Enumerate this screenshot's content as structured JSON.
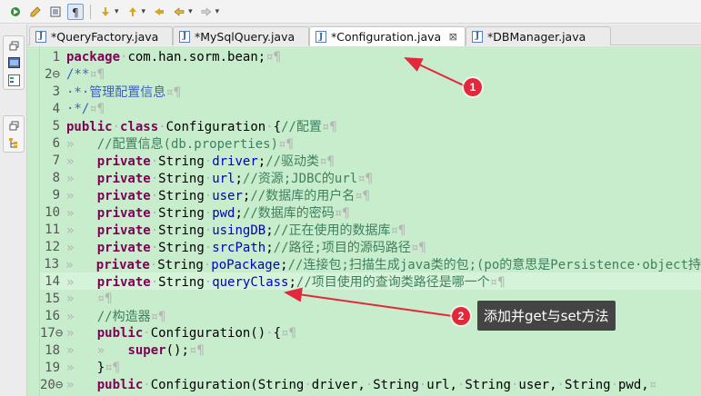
{
  "toolbar": {
    "buttons": [
      {
        "icon": "run-last-icon"
      },
      {
        "icon": "highlight-icon"
      },
      {
        "icon": "block-selection-icon"
      },
      {
        "icon": "show-whitespace-icon"
      },
      {
        "icon": "next-annotation-icon"
      },
      {
        "icon": "previous-annotation-icon"
      },
      {
        "icon": "last-edit-location-icon"
      },
      {
        "icon": "back-icon"
      },
      {
        "icon": "forward-icon"
      }
    ]
  },
  "tabs": [
    {
      "label": "*QueryFactory.java",
      "active": false
    },
    {
      "label": "*MySqlQuery.java",
      "active": false
    },
    {
      "label": "*Configuration.java",
      "active": true,
      "close": "⊠"
    },
    {
      "label": "*DBManager.java",
      "active": false
    }
  ],
  "tab_icon_glyph": "J",
  "code": {
    "lines": [
      {
        "n": "1",
        "tokens": [
          [
            "kw",
            "package"
          ],
          [
            "ws",
            "·"
          ],
          [
            "",
            "com.han.sorm.bean;"
          ],
          [
            "ws",
            "¤¶"
          ]
        ]
      },
      {
        "n": "2⊖",
        "tokens": [
          [
            "doc",
            "/**"
          ],
          [
            "ws",
            "¤¶"
          ]
        ]
      },
      {
        "n": "3",
        "tokens": [
          [
            "doc",
            "·*·管理配置信息"
          ],
          [
            "ws",
            "¤¶"
          ]
        ]
      },
      {
        "n": "4",
        "tokens": [
          [
            "doc",
            "·*/"
          ],
          [
            "ws",
            "¤¶"
          ]
        ]
      },
      {
        "n": "5",
        "tokens": [
          [
            "kw",
            "public"
          ],
          [
            "ws",
            "·"
          ],
          [
            "kw",
            "class"
          ],
          [
            "ws",
            "·"
          ],
          [
            "",
            "Configuration"
          ],
          [
            "ws",
            "·"
          ],
          [
            "",
            "{"
          ],
          [
            "cm",
            "//配置"
          ],
          [
            "ws",
            "¤¶"
          ]
        ]
      },
      {
        "n": "6",
        "tokens": [
          [
            "ws",
            "»   "
          ],
          [
            "cm",
            "//配置信息(db.properties)"
          ],
          [
            "ws",
            "¤¶"
          ]
        ]
      },
      {
        "n": "7",
        "tokens": [
          [
            "ws",
            "»   "
          ],
          [
            "kw",
            "private"
          ],
          [
            "ws",
            "·"
          ],
          [
            "",
            "String"
          ],
          [
            "ws",
            "·"
          ],
          [
            "fd",
            "driver"
          ],
          [
            "",
            ";"
          ],
          [
            "cm",
            "//驱动类"
          ],
          [
            "ws",
            "¤¶"
          ]
        ]
      },
      {
        "n": "8",
        "tokens": [
          [
            "ws",
            "»   "
          ],
          [
            "kw",
            "private"
          ],
          [
            "ws",
            "·"
          ],
          [
            "",
            "String"
          ],
          [
            "ws",
            "·"
          ],
          [
            "fd",
            "url"
          ],
          [
            "",
            ";"
          ],
          [
            "cm",
            "//资源;JDBC的url"
          ],
          [
            "ws",
            "¤¶"
          ]
        ]
      },
      {
        "n": "9",
        "tokens": [
          [
            "ws",
            "»   "
          ],
          [
            "kw",
            "private"
          ],
          [
            "ws",
            "·"
          ],
          [
            "",
            "String"
          ],
          [
            "ws",
            "·"
          ],
          [
            "fd",
            "user"
          ],
          [
            "",
            ";"
          ],
          [
            "cm",
            "//数据库的用户名"
          ],
          [
            "ws",
            "¤¶"
          ]
        ]
      },
      {
        "n": "10",
        "tokens": [
          [
            "ws",
            "»   "
          ],
          [
            "kw",
            "private"
          ],
          [
            "ws",
            "·"
          ],
          [
            "",
            "String"
          ],
          [
            "ws",
            "·"
          ],
          [
            "fd",
            "pwd"
          ],
          [
            "",
            ";"
          ],
          [
            "cm",
            "//数据库的密码"
          ],
          [
            "ws",
            "¤¶"
          ]
        ]
      },
      {
        "n": "11",
        "tokens": [
          [
            "ws",
            "»   "
          ],
          [
            "kw",
            "private"
          ],
          [
            "ws",
            "·"
          ],
          [
            "",
            "String"
          ],
          [
            "ws",
            "·"
          ],
          [
            "fd",
            "usingDB"
          ],
          [
            "",
            ";"
          ],
          [
            "cm",
            "//正在使用的数据库"
          ],
          [
            "ws",
            "¤¶"
          ]
        ]
      },
      {
        "n": "12",
        "tokens": [
          [
            "ws",
            "»   "
          ],
          [
            "kw",
            "private"
          ],
          [
            "ws",
            "·"
          ],
          [
            "",
            "String"
          ],
          [
            "ws",
            "·"
          ],
          [
            "fd",
            "srcPath"
          ],
          [
            "",
            ";"
          ],
          [
            "cm",
            "//路径;项目的源码路径"
          ],
          [
            "ws",
            "¤¶"
          ]
        ]
      },
      {
        "n": "13",
        "tokens": [
          [
            "ws",
            "»   "
          ],
          [
            "kw",
            "private"
          ],
          [
            "ws",
            "·"
          ],
          [
            "",
            "String"
          ],
          [
            "ws",
            "·"
          ],
          [
            "fd",
            "poPackage"
          ],
          [
            "",
            ";"
          ],
          [
            "cm",
            "//连接包;扫描生成java类的包;(po的意思是Persistence·object持"
          ]
        ]
      },
      {
        "n": "14",
        "tokens": [
          [
            "ws",
            "»   "
          ],
          [
            "kw",
            "private"
          ],
          [
            "ws",
            "·"
          ],
          [
            "",
            "String"
          ],
          [
            "ws",
            "·"
          ],
          [
            "fd",
            "queryClass"
          ],
          [
            "",
            ";"
          ],
          [
            "cm",
            "//项目使用的查询类路径是哪一个"
          ],
          [
            "ws",
            "¤¶"
          ]
        ],
        "current": true
      },
      {
        "n": "15",
        "tokens": [
          [
            "ws",
            "»   ¤¶"
          ]
        ]
      },
      {
        "n": "16",
        "tokens": [
          [
            "ws",
            "»   "
          ],
          [
            "cm",
            "//构造器"
          ],
          [
            "ws",
            "¤¶"
          ]
        ]
      },
      {
        "n": "17⊖",
        "tokens": [
          [
            "ws",
            "»   "
          ],
          [
            "kw",
            "public"
          ],
          [
            "ws",
            "·"
          ],
          [
            "",
            "Configuration()"
          ],
          [
            "ws",
            "·"
          ],
          [
            "",
            "{"
          ],
          [
            "ws",
            "¤¶"
          ]
        ]
      },
      {
        "n": "18",
        "tokens": [
          [
            "ws",
            "»   »   "
          ],
          [
            "kw",
            "super"
          ],
          [
            "",
            "();"
          ],
          [
            "ws",
            "¤¶"
          ]
        ]
      },
      {
        "n": "19",
        "tokens": [
          [
            "ws",
            "»   "
          ],
          [
            "",
            "}"
          ],
          [
            "ws",
            "¤¶"
          ]
        ]
      },
      {
        "n": "20⊖",
        "tokens": [
          [
            "ws",
            "»   "
          ],
          [
            "kw",
            "public"
          ],
          [
            "ws",
            "·"
          ],
          [
            "",
            "Configuration(String"
          ],
          [
            "ws",
            "·"
          ],
          [
            "",
            "driver,"
          ],
          [
            "ws",
            "·"
          ],
          [
            "",
            "String"
          ],
          [
            "ws",
            "·"
          ],
          [
            "",
            "url,"
          ],
          [
            "ws",
            "·"
          ],
          [
            "",
            "String"
          ],
          [
            "ws",
            "·"
          ],
          [
            "",
            "user,"
          ],
          [
            "ws",
            "·"
          ],
          [
            "",
            "String"
          ],
          [
            "ws",
            "·"
          ],
          [
            "",
            "pwd,"
          ],
          [
            "ws",
            "¤"
          ]
        ]
      }
    ]
  },
  "annotations": {
    "badge1": "1",
    "badge2": "2",
    "callout2": "添加并get与set方法",
    "color": "#e4283c"
  },
  "colors": {
    "editor_bg": "#c7edcc",
    "keyword": "#7f0055",
    "comment": "#3f7f5f",
    "field": "#0000c0"
  }
}
